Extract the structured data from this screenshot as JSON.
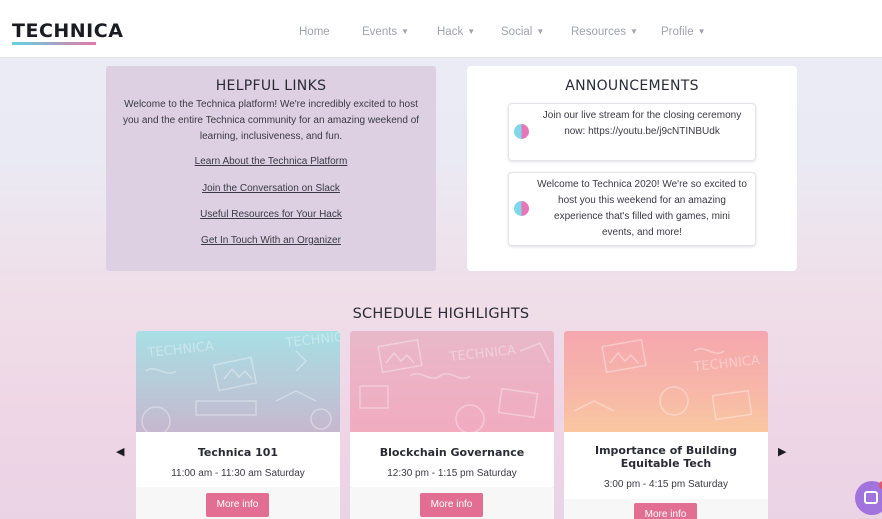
{
  "brand": {
    "name": "TECHNICA"
  },
  "nav": [
    {
      "label": "Home",
      "dropdown": false
    },
    {
      "label": "Events",
      "dropdown": true
    },
    {
      "label": "Hack",
      "dropdown": true
    },
    {
      "label": "Social",
      "dropdown": true
    },
    {
      "label": "Resources",
      "dropdown": true
    },
    {
      "label": "Profile",
      "dropdown": true
    }
  ],
  "helpful_links": {
    "title": "HELPFUL LINKS",
    "intro": "Welcome to the Technica platform! We're incredibly excited to host you and the entire Technica community for an amazing weekend of learning, inclusiveness, and fun.",
    "links": [
      "Learn About the Technica Platform",
      "Join the Conversation on Slack",
      "Useful Resources for Your Hack",
      "Get In Touch With an Organizer"
    ]
  },
  "announcements": {
    "title": "ANNOUNCEMENTS",
    "items": [
      "Join our live stream for the closing ceremony now: https://youtu.be/j9cNTINBUdk",
      "Welcome to Technica 2020! We're so excited to host you this weekend for an amazing experience that's filled with games, mini events, and more!"
    ]
  },
  "schedule": {
    "title": "SCHEDULE HIGHLIGHTS",
    "prev_icon": "triangle-left-icon",
    "next_icon": "triangle-right-icon",
    "events": [
      {
        "name": "Technica 101",
        "time": "11:00 am - 11:30 am Saturday",
        "button": "More info",
        "image_text": "TECHNICA",
        "colors": [
          "#a7dde4",
          "#c6b9cf"
        ]
      },
      {
        "name": "Blockchain Governance",
        "time": "12:30 pm - 1:15 pm Saturday",
        "button": "More info",
        "image_text": "TECHNICA",
        "colors": [
          "#ebb3c6",
          "#f0adc2"
        ]
      },
      {
        "name": "Importance of Building Equitable Tech",
        "time": "3:00 pm - 4:15 pm Saturday",
        "button": "More info",
        "image_text": "TECHNICA",
        "colors": [
          "#f5a9b0",
          "#f9c7a0"
        ]
      }
    ]
  },
  "chat": {
    "icon": "chat-bubble-icon"
  }
}
